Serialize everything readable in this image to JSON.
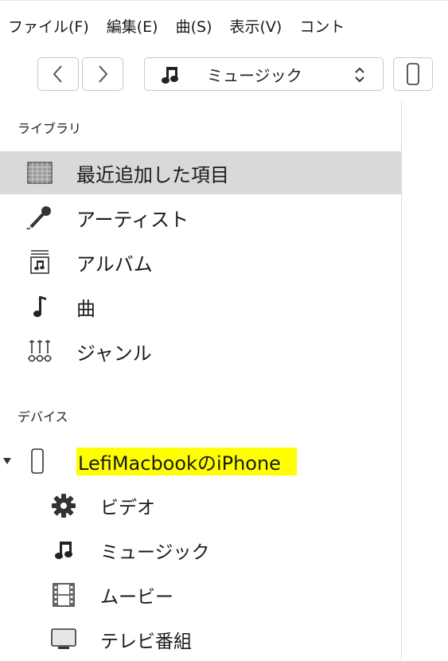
{
  "menubar": {
    "items": [
      "ファイル(F)",
      "編集(E)",
      "曲(S)",
      "表示(V)",
      "コント"
    ]
  },
  "toolbar": {
    "back_icon": "chevron-left-icon",
    "forward_icon": "chevron-right-icon",
    "media_selector": {
      "icon": "music-note-icon",
      "label": "ミュージック"
    },
    "device_icon": "iphone-icon"
  },
  "sidebar": {
    "library_header": "ライブラリ",
    "library_items": [
      {
        "label": "最近追加した項目",
        "icon": "recently-added-grid-icon",
        "selected": true
      },
      {
        "label": "アーティスト",
        "icon": "microphone-icon"
      },
      {
        "label": "アルバム",
        "icon": "album-icon"
      },
      {
        "label": "曲",
        "icon": "music-note-icon"
      },
      {
        "label": "ジャンル",
        "icon": "genre-guitars-icon"
      }
    ],
    "devices_header": "デバイス",
    "device": {
      "name": "LefiMacbookのiPhone",
      "expanded": true,
      "highlight": "#ffff00"
    },
    "device_items": [
      {
        "label": "ビデオ",
        "icon": "gear-icon"
      },
      {
        "label": "ミュージック",
        "icon": "music-note-icon"
      },
      {
        "label": "ムービー",
        "icon": "film-icon"
      },
      {
        "label": "テレビ番組",
        "icon": "tv-monitor-icon"
      }
    ]
  },
  "colors": {
    "selected_row": "#d9d9d9",
    "highlight": "#ffff00"
  }
}
